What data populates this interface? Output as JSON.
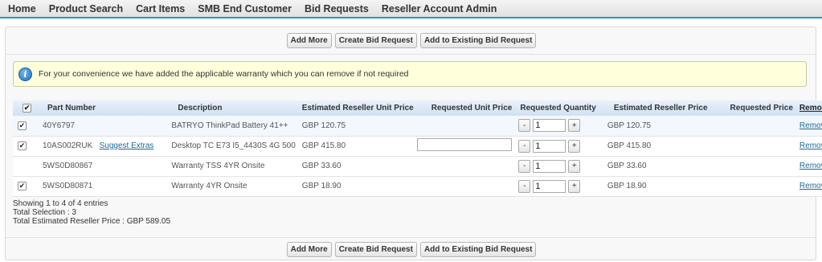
{
  "nav": [
    "Home",
    "Product Search",
    "Cart Items",
    "SMB End Customer",
    "Bid Requests",
    "Reseller Account Admin"
  ],
  "buttons": {
    "add_more": "Add More",
    "create_bid": "Create Bid Request",
    "add_existing": "Add to Existing Bid Request"
  },
  "info": {
    "icon": "info-icon",
    "glyph": "i",
    "message": "For your convenience we have added the applicable warranty which you can remove if not required"
  },
  "table": {
    "columns": {
      "part_number": "Part Number",
      "description": "Description",
      "est_unit_price": "Estimated Reseller Unit Price",
      "req_unit_price": "Requested Unit Price",
      "req_qty": "Requested Quantity",
      "est_price": "Estimated Reseller Price",
      "req_price": "Requested Price",
      "remove_all": "Remove All"
    },
    "header_checked": true,
    "rows": [
      {
        "checked": true,
        "part": "40Y6797",
        "extra": "",
        "desc": "BATRYO ThinkPad Battery 41++",
        "unit": "GBP 120.75",
        "has_input": false,
        "qty": "1",
        "price": "GBP 120.75",
        "remove": "Remove"
      },
      {
        "checked": true,
        "part": "10AS002RUK",
        "extra": "Suggest Extras",
        "desc": "Desktop TC E73 I5_4430S 4G 500",
        "unit": "GBP 415.80",
        "has_input": true,
        "qty": "1",
        "price": "GBP 415.80",
        "remove": "Remove"
      },
      {
        "checked": false,
        "part": "5WS0D80867",
        "extra": "",
        "desc": "Warranty TSS 4YR Onsite",
        "unit": "GBP 33.60",
        "has_input": false,
        "qty": "1",
        "price": "GBP 33.60",
        "remove": "Remove"
      },
      {
        "checked": true,
        "part": "5WS0D80871",
        "extra": "",
        "desc": "Warranty 4YR Onsite",
        "unit": "GBP 18.90",
        "has_input": false,
        "qty": "1",
        "price": "GBP 18.90",
        "remove": "Remove"
      }
    ]
  },
  "qty_minus": "-",
  "qty_plus": "+",
  "check_glyph": "✔",
  "summary": {
    "showing": "Showing 1 to 4 of 4 entries",
    "total_selection": "Total Selection : 3",
    "total_price": "Total Estimated Reseller Price : GBP 589.05"
  }
}
